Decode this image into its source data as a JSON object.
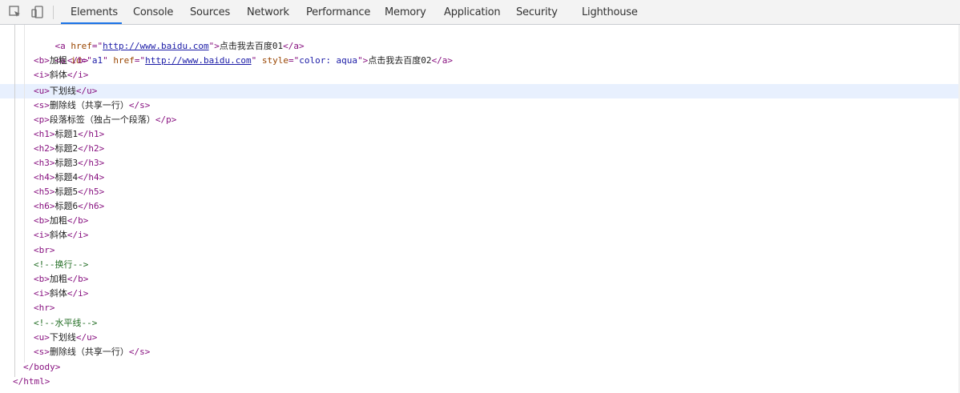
{
  "toolbar": {
    "tabs": [
      {
        "label": "Elements",
        "active": true
      },
      {
        "label": "Console"
      },
      {
        "label": "Sources"
      },
      {
        "label": "Network"
      },
      {
        "label": "Performance"
      },
      {
        "label": "Memory"
      },
      {
        "label": "Application"
      },
      {
        "label": "Security"
      },
      {
        "label": "Lighthouse"
      }
    ],
    "icons": [
      "inspect-element-icon",
      "device-toolbar-icon"
    ],
    "accent_color": "#1a73e8"
  },
  "dom": {
    "lines": [
      {
        "open": "<a ",
        "href_name": "href",
        "eq1": "=\"",
        "href_val": "http://www.baidu.com",
        "close1": "\">",
        "text": "点击我去百度01",
        "end": "</a>"
      },
      {
        "open": "<a ",
        "id_name": "id",
        "id_eq": "=\"",
        "id_val": "a1",
        "id_close": "\" ",
        "href_name": "href",
        "eq1": "=\"",
        "href_val": "http://www.baidu.com",
        "close_q": "\" ",
        "style_name": "style",
        "style_eq": "=\"",
        "style_val": "color: aqua",
        "close1": "\">",
        "text": "点击我去百度02",
        "end": "</a>"
      },
      {
        "open": "<b>",
        "text": "加粗",
        "end": "</b>"
      },
      {
        "open": "<i>",
        "text": "斜体",
        "end": "</i>"
      },
      {
        "open": "<u>",
        "text": "下划线",
        "end": "</u>"
      },
      {
        "open": "<s>",
        "text": "删除线（共享一行）",
        "end": "</s>"
      },
      {
        "open": "<p>",
        "text": "段落标签（独占一个段落）",
        "end": "</p>"
      },
      {
        "open": "<h1>",
        "text": "标题1",
        "end": "</h1>"
      },
      {
        "open": "<h2>",
        "text": "标题2",
        "end": "</h2>"
      },
      {
        "open": "<h3>",
        "text": "标题3",
        "end": "</h3>"
      },
      {
        "open": "<h4>",
        "text": "标题4",
        "end": "</h4>"
      },
      {
        "open": "<h5>",
        "text": "标题5",
        "end": "</h5>"
      },
      {
        "open": "<h6>",
        "text": "标题6",
        "end": "</h6>"
      },
      {
        "open": "<b>",
        "text": "加粗",
        "end": "</b>"
      },
      {
        "open": "<i>",
        "text": "斜体",
        "end": "</i>"
      },
      {
        "open": "<br>"
      },
      {
        "comment": "<!--换行-->"
      },
      {
        "open": "<b>",
        "text": "加粗",
        "end": "</b>"
      },
      {
        "open": "<i>",
        "text": "斜体",
        "end": "</i>"
      },
      {
        "open": "<hr>"
      },
      {
        "comment": "<!--水平线-->"
      },
      {
        "open": "<u>",
        "text": "下划线",
        "end": "</u>"
      },
      {
        "open": "<s>",
        "text": "删除线（共享一行）",
        "end": "</s>"
      },
      {
        "open": "</body>"
      },
      {
        "open": "</html>"
      }
    ],
    "highlighted_line_index": 4
  }
}
